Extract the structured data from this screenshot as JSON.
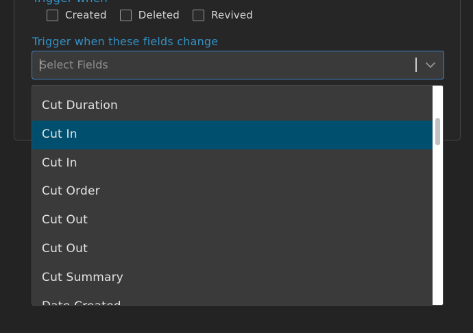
{
  "trigger": {
    "heading": "Trigger when",
    "options": [
      {
        "label": "Created",
        "checked": false
      },
      {
        "label": "Deleted",
        "checked": false
      },
      {
        "label": "Revived",
        "checked": false
      }
    ]
  },
  "fields": {
    "label": "Trigger when these fields change",
    "placeholder": "Select Fields"
  },
  "dropdown": {
    "options": [
      {
        "label": "Cut Duration"
      },
      {
        "label": "Cut In",
        "selected": true
      },
      {
        "label": "Cut In"
      },
      {
        "label": "Cut Order"
      },
      {
        "label": "Cut Out"
      },
      {
        "label": "Cut Out"
      },
      {
        "label": "Cut Summary"
      },
      {
        "label": "Date Created"
      }
    ]
  },
  "colors": {
    "accent": "#3391c6",
    "focus_border": "#3e84c7",
    "selected_option": "#014f6f",
    "background": "#232323"
  },
  "icons": {
    "dropdown_toggle": "chevron-down-icon"
  }
}
